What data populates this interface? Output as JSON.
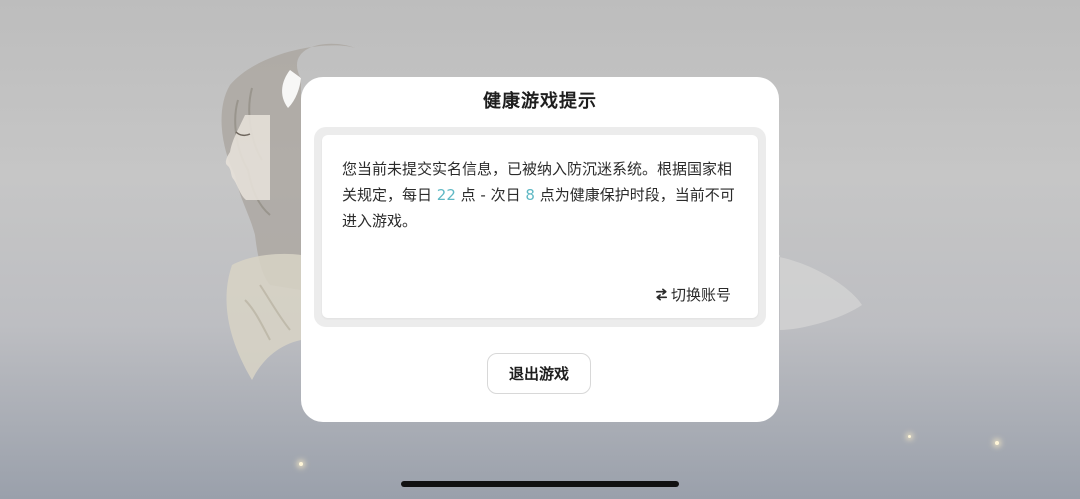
{
  "dialog": {
    "title": "健康游戏提示",
    "notice_part1": "您当前未提交实名信息，已被纳入防沉迷系统。根据国家相关规定，每日 ",
    "start_hour": "22",
    "notice_part2": " 点 - 次日 ",
    "end_hour": "8",
    "notice_part3": " 点为健康保护时段，当前不可进入游戏。",
    "switch_account_label": "切换账号",
    "exit_button_label": "退出游戏",
    "highlight_color": "#5fb8c4"
  },
  "icons": {
    "switch": "swap-arrows-icon"
  }
}
